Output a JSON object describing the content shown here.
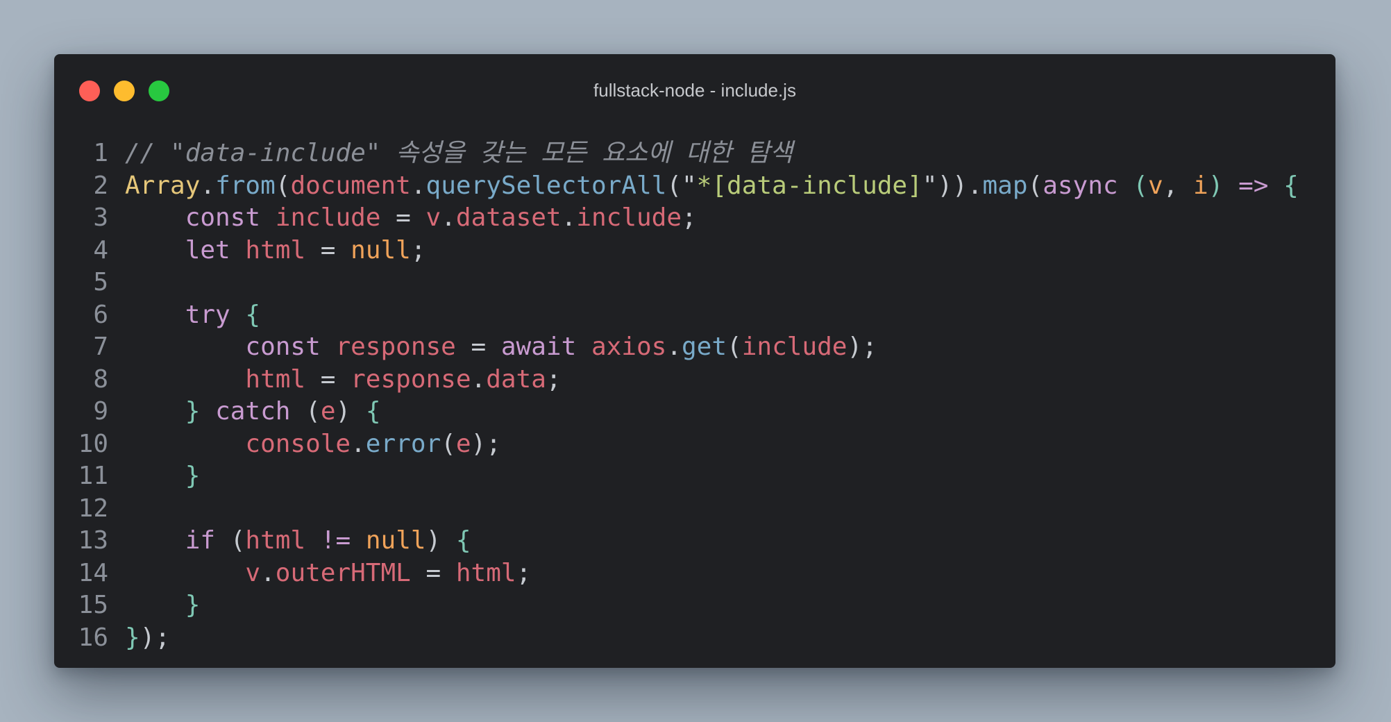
{
  "window": {
    "title": "fullstack-node - include.js",
    "controls": [
      "close-button",
      "minimize-button",
      "maximize-button"
    ]
  },
  "colors": {
    "comment": "#8c9098",
    "class": "#e6c77a",
    "function": "#79aac9",
    "variable": "#d76a77",
    "string": "#b9cc7a",
    "keyword": "#c99bd1",
    "parameter": "#f0a35a",
    "constant": "#f0a35a",
    "brace": "#7fc8b4",
    "punctuation": "#c6cad0"
  },
  "code_lines": [
    {
      "num": "1",
      "tokens": [
        [
          "cmt",
          "// \"data-include\" 속성을 갖는 모든 요소에 대한 탐색"
        ]
      ]
    },
    {
      "num": "2",
      "tokens": [
        [
          "class",
          "Array"
        ],
        [
          "punc",
          "."
        ],
        [
          "fn",
          "from"
        ],
        [
          "punc",
          "("
        ],
        [
          "var",
          "document"
        ],
        [
          "punc",
          "."
        ],
        [
          "fn",
          "querySelectorAll"
        ],
        [
          "punc",
          "(\""
        ],
        [
          "str",
          "*[data-include]"
        ],
        [
          "punc",
          "\"))."
        ],
        [
          "fn",
          "map"
        ],
        [
          "punc",
          "("
        ],
        [
          "kw",
          "async"
        ],
        [
          "punc",
          " "
        ],
        [
          "brace",
          "("
        ],
        [
          "param",
          "v"
        ],
        [
          "punc",
          ", "
        ],
        [
          "param",
          "i"
        ],
        [
          "brace",
          ")"
        ],
        [
          "punc",
          " "
        ],
        [
          "kw",
          "=>"
        ],
        [
          "punc",
          " "
        ],
        [
          "brace",
          "{"
        ]
      ]
    },
    {
      "num": "3",
      "tokens": [
        [
          "punc",
          "    "
        ],
        [
          "kw",
          "const"
        ],
        [
          "punc",
          " "
        ],
        [
          "var",
          "include"
        ],
        [
          "punc",
          " = "
        ],
        [
          "var",
          "v"
        ],
        [
          "punc",
          "."
        ],
        [
          "var",
          "dataset"
        ],
        [
          "punc",
          "."
        ],
        [
          "var",
          "include"
        ],
        [
          "punc",
          ";"
        ]
      ]
    },
    {
      "num": "4",
      "tokens": [
        [
          "punc",
          "    "
        ],
        [
          "kw",
          "let"
        ],
        [
          "punc",
          " "
        ],
        [
          "var",
          "html"
        ],
        [
          "punc",
          " = "
        ],
        [
          "const",
          "null"
        ],
        [
          "punc",
          ";"
        ]
      ]
    },
    {
      "num": "5",
      "tokens": []
    },
    {
      "num": "6",
      "tokens": [
        [
          "punc",
          "    "
        ],
        [
          "kw",
          "try"
        ],
        [
          "punc",
          " "
        ],
        [
          "brace",
          "{"
        ]
      ]
    },
    {
      "num": "7",
      "tokens": [
        [
          "punc",
          "        "
        ],
        [
          "kw",
          "const"
        ],
        [
          "punc",
          " "
        ],
        [
          "var",
          "response"
        ],
        [
          "punc",
          " = "
        ],
        [
          "kw",
          "await"
        ],
        [
          "punc",
          " "
        ],
        [
          "var",
          "axios"
        ],
        [
          "punc",
          "."
        ],
        [
          "fn",
          "get"
        ],
        [
          "punc",
          "("
        ],
        [
          "var",
          "include"
        ],
        [
          "punc",
          ");"
        ]
      ]
    },
    {
      "num": "8",
      "tokens": [
        [
          "punc",
          "        "
        ],
        [
          "var",
          "html"
        ],
        [
          "punc",
          " = "
        ],
        [
          "var",
          "response"
        ],
        [
          "punc",
          "."
        ],
        [
          "var",
          "data"
        ],
        [
          "punc",
          ";"
        ]
      ]
    },
    {
      "num": "9",
      "tokens": [
        [
          "punc",
          "    "
        ],
        [
          "brace",
          "}"
        ],
        [
          "punc",
          " "
        ],
        [
          "kw",
          "catch"
        ],
        [
          "punc",
          " ("
        ],
        [
          "var",
          "e"
        ],
        [
          "punc",
          ") "
        ],
        [
          "brace",
          "{"
        ]
      ]
    },
    {
      "num": "10",
      "tokens": [
        [
          "punc",
          "        "
        ],
        [
          "var",
          "console"
        ],
        [
          "punc",
          "."
        ],
        [
          "fn",
          "error"
        ],
        [
          "punc",
          "("
        ],
        [
          "var",
          "e"
        ],
        [
          "punc",
          ");"
        ]
      ]
    },
    {
      "num": "11",
      "tokens": [
        [
          "punc",
          "    "
        ],
        [
          "brace",
          "}"
        ]
      ]
    },
    {
      "num": "12",
      "tokens": []
    },
    {
      "num": "13",
      "tokens": [
        [
          "punc",
          "    "
        ],
        [
          "kw",
          "if"
        ],
        [
          "punc",
          " ("
        ],
        [
          "var",
          "html"
        ],
        [
          "punc",
          " "
        ],
        [
          "kw",
          "!="
        ],
        [
          "punc",
          " "
        ],
        [
          "const",
          "null"
        ],
        [
          "punc",
          ") "
        ],
        [
          "brace",
          "{"
        ]
      ]
    },
    {
      "num": "14",
      "tokens": [
        [
          "punc",
          "        "
        ],
        [
          "var",
          "v"
        ],
        [
          "punc",
          "."
        ],
        [
          "var",
          "outerHTML"
        ],
        [
          "punc",
          " = "
        ],
        [
          "var",
          "html"
        ],
        [
          "punc",
          ";"
        ]
      ]
    },
    {
      "num": "15",
      "tokens": [
        [
          "punc",
          "    "
        ],
        [
          "brace",
          "}"
        ]
      ]
    },
    {
      "num": "16",
      "tokens": [
        [
          "brace",
          "}"
        ],
        [
          "punc",
          ");"
        ]
      ]
    }
  ]
}
